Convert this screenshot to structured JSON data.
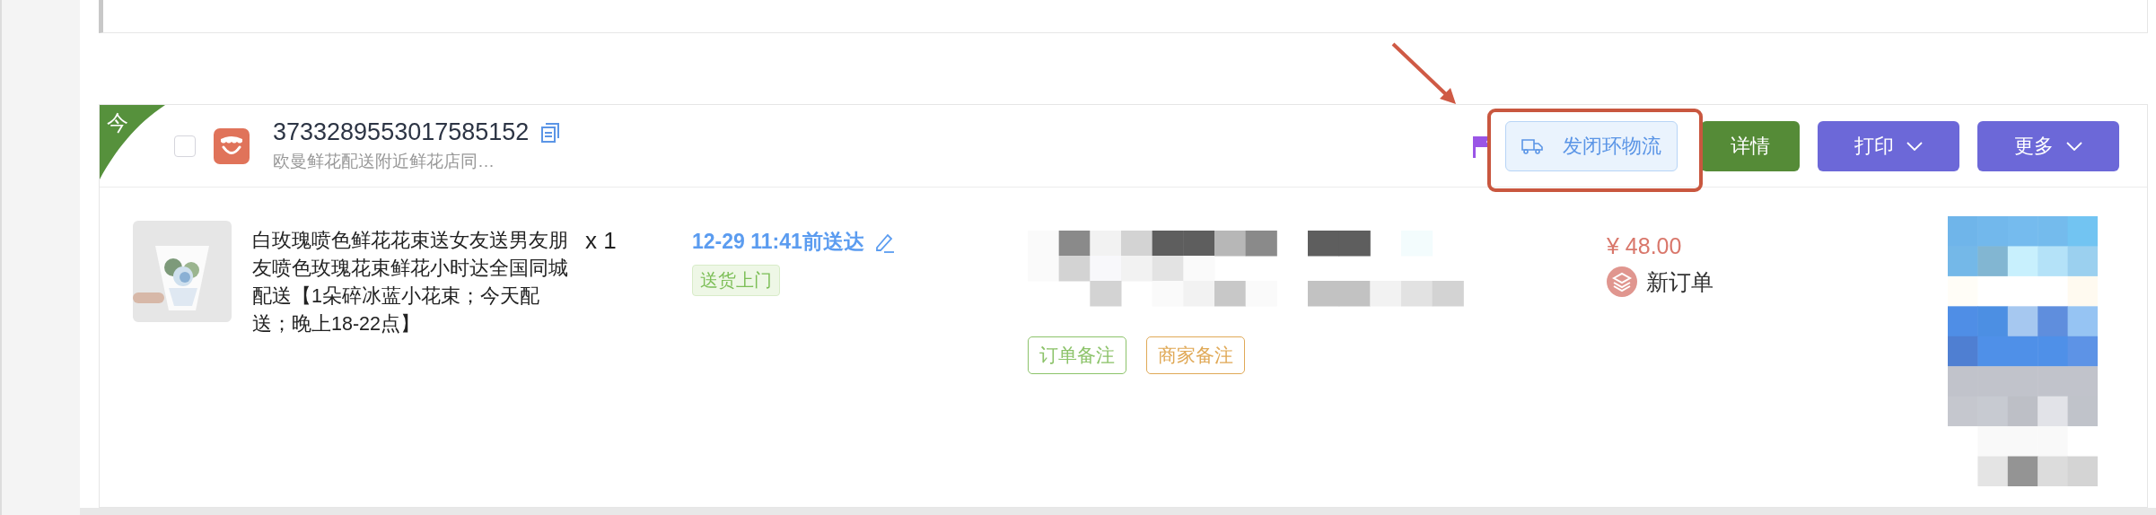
{
  "order": {
    "today_badge": "今",
    "checked": false,
    "order_number": "3733289553017585152",
    "shop_name": "欧曼鲜花配送附近鲜花店同…",
    "flagged": true,
    "actions": [
      {
        "kind": "logistics",
        "label": "发闭环物流"
      },
      {
        "kind": "detail",
        "label": "详情"
      },
      {
        "kind": "dropdown",
        "label": "打印"
      },
      {
        "kind": "dropdown",
        "label": "更多"
      }
    ]
  },
  "item": {
    "title": "白玫瑰喷色鲜花花束送女友送男友朋友喷色玫瑰花束鲜花小时达全国同城配送【1朵碎冰蓝小花束；今天配送；晚上18-22点】",
    "quantity": "x 1",
    "delivery_time": "12-29 11:41前送达",
    "delivery_tag": "送货上门",
    "note_tags": [
      {
        "label": "订单备注",
        "color": "#8cc36a"
      },
      {
        "label": "商家备注",
        "color": "#e0a957"
      }
    ],
    "price": "¥ 48.00",
    "status": "新订单"
  }
}
